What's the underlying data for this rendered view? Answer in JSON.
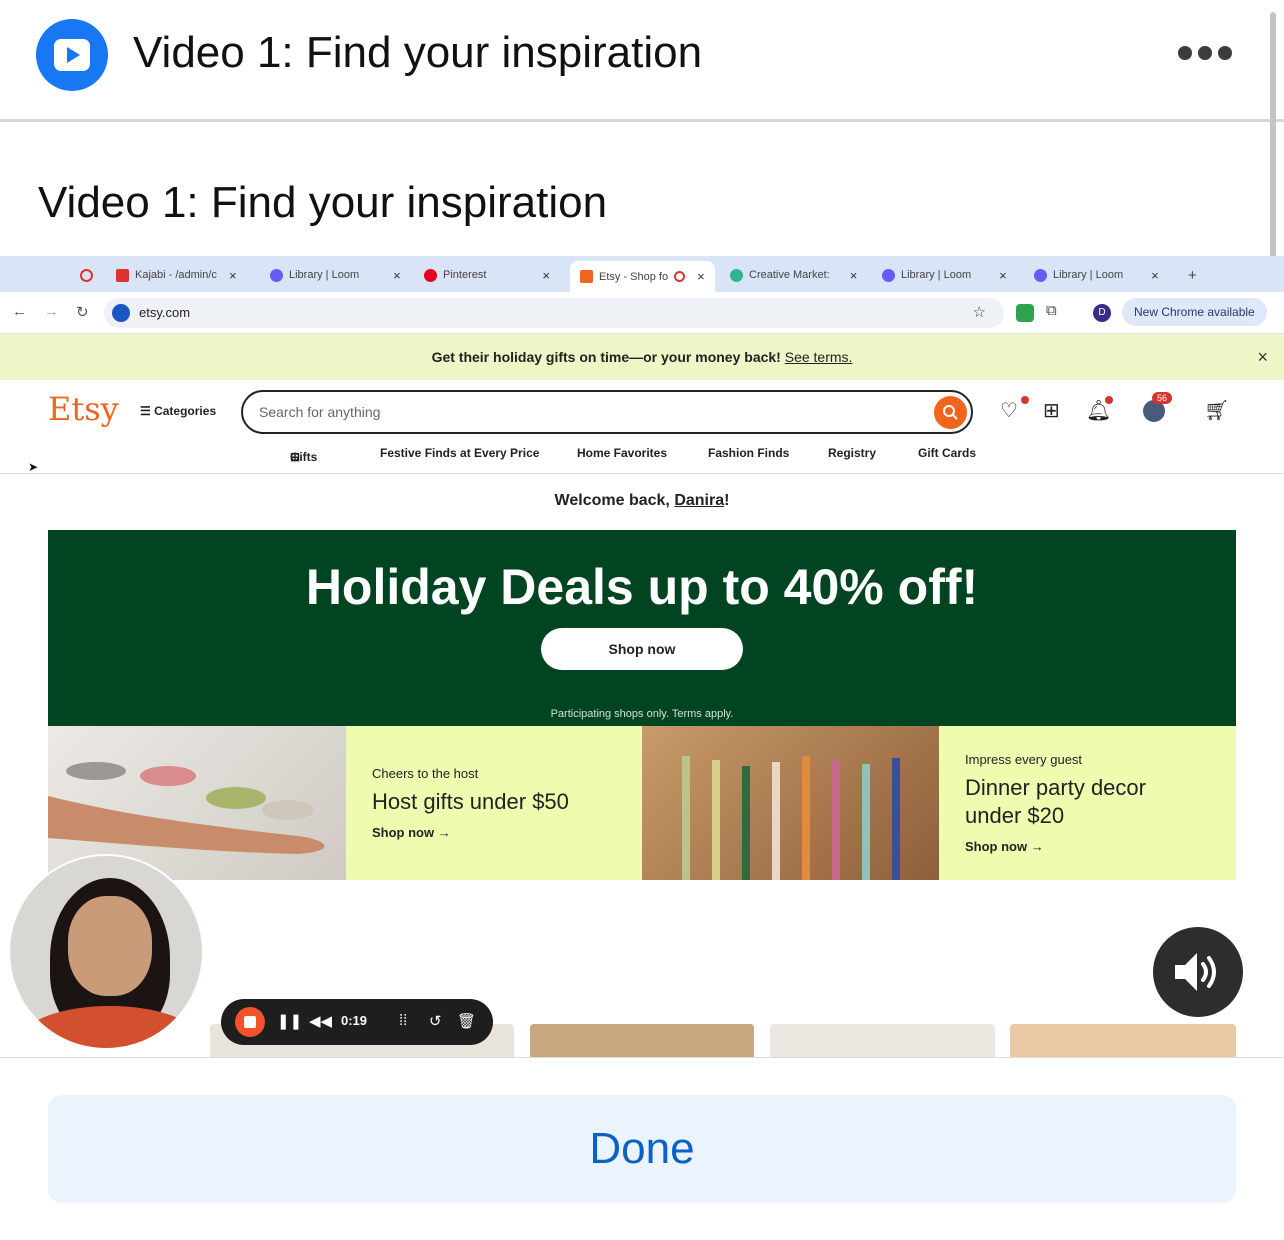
{
  "header": {
    "title": "Video 1: Find your inspiration",
    "more_label": "More options"
  },
  "heading": "Video 1: Find your inspiration",
  "browser": {
    "tabs": [
      {
        "label": "Kajabi - /admin/c"
      },
      {
        "label": "Library | Loom"
      },
      {
        "label": "Pinterest"
      },
      {
        "label": "Etsy - Shop fo"
      },
      {
        "label": "Creative Market:"
      },
      {
        "label": "Library | Loom"
      },
      {
        "label": "Library | Loom"
      }
    ],
    "url": "etsy.com",
    "chrome_update": "New Chrome available"
  },
  "etsy": {
    "promo": "Get their holiday gifts on time—or your money back!",
    "promo_link": "See terms.",
    "logo": "Etsy",
    "categories": "Categories",
    "search_placeholder": "Search for anything",
    "cart_badge": "56",
    "subnav": [
      "Gifts",
      "Festive Finds at Every Price",
      "Home Favorites",
      "Fashion Finds",
      "Registry",
      "Gift Cards"
    ],
    "welcome_prefix": "Welcome back,",
    "welcome_name": "Danira",
    "welcome_suffix": "!",
    "hero": {
      "title": "Holiday Deals up to 40% off!",
      "button": "Shop now",
      "fine_print": "Participating shops only. Terms apply."
    },
    "tile1": {
      "eyebrow": "Cheers to the host",
      "headline": "Host gifts under $50",
      "link": "Shop now →"
    },
    "tile2": {
      "eyebrow": "Impress every guest",
      "headline": "Dinner party decor under $20",
      "link": "Shop now →"
    }
  },
  "loom": {
    "time": "0:19"
  },
  "footer": {
    "done_label": "Done"
  },
  "colors": {
    "accent": "#1877f2",
    "etsy_orange": "#f1641e",
    "hero_green": "#014421",
    "tile_yellow": "#eefcb0",
    "done_text": "#0b62c4"
  }
}
